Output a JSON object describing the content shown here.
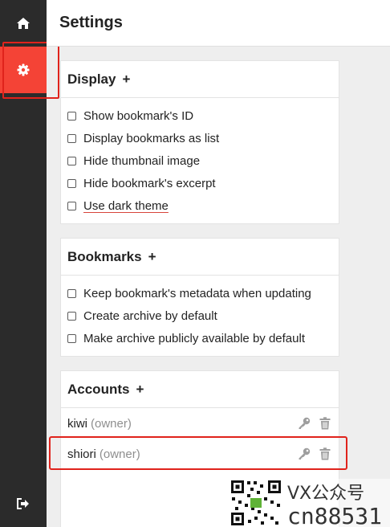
{
  "page": {
    "title": "Settings"
  },
  "sidebar": {
    "items": [
      {
        "name": "home",
        "icon": "home-icon"
      },
      {
        "name": "settings",
        "icon": "gear-icon",
        "active": true
      },
      {
        "name": "logout",
        "icon": "logout-icon"
      }
    ]
  },
  "display": {
    "title": "Display",
    "plus": "+",
    "options": [
      {
        "label": "Show bookmark's ID",
        "checked": false
      },
      {
        "label": "Display bookmarks as list",
        "checked": false
      },
      {
        "label": "Hide thumbnail image",
        "checked": false
      },
      {
        "label": "Hide bookmark's excerpt",
        "checked": false
      },
      {
        "label": "Use dark theme",
        "checked": false
      }
    ]
  },
  "bookmarks": {
    "title": "Bookmarks",
    "plus": "+",
    "options": [
      {
        "label": "Keep bookmark's metadata when updating",
        "checked": false
      },
      {
        "label": "Create archive by default",
        "checked": false
      },
      {
        "label": "Make archive publicly available by default",
        "checked": false
      }
    ]
  },
  "accounts": {
    "title": "Accounts",
    "plus": "+",
    "items": [
      {
        "name": "kiwi",
        "role": "(owner)"
      },
      {
        "name": "shiori",
        "role": "(owner)"
      }
    ]
  },
  "watermark": {
    "line1": "VX公众号",
    "line2": "cn88531"
  },
  "colors": {
    "accent": "#f44336",
    "sidebar": "#2b2b2b",
    "highlight": "#e0231c"
  }
}
